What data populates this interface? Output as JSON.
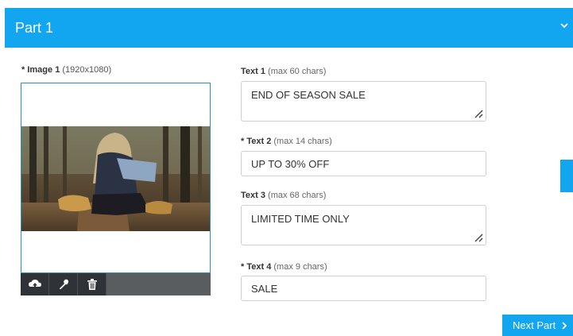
{
  "header": {
    "title": "Part 1",
    "toggle_icon": "chevron-down-icon"
  },
  "image_field": {
    "required_marker": "*",
    "label": "Image 1",
    "hint": "(1920x1080)",
    "toolbar": {
      "icons": [
        "upload-icon",
        "wrench-icon",
        "trash-icon"
      ]
    }
  },
  "fields": [
    {
      "required": "",
      "label": "Text 1",
      "hint": "(max 60 chars)",
      "value": "END OF SEASON SALE"
    },
    {
      "required": "* ",
      "label": "Text 2",
      "hint": "(max 14 chars)",
      "value": "UP TO 30% OFF"
    },
    {
      "required": "",
      "label": "Text 3",
      "hint": "(max 68 chars)",
      "value": "LIMITED TIME ONLY"
    },
    {
      "required": "* ",
      "label": "Text 4",
      "hint": "(max 9 chars)",
      "value": "SALE"
    }
  ],
  "next_button": {
    "label": "Next Part",
    "icon": "chevron-right-icon"
  },
  "colors": {
    "accent": "#12a6f0",
    "toolbar": "#2f3236"
  }
}
